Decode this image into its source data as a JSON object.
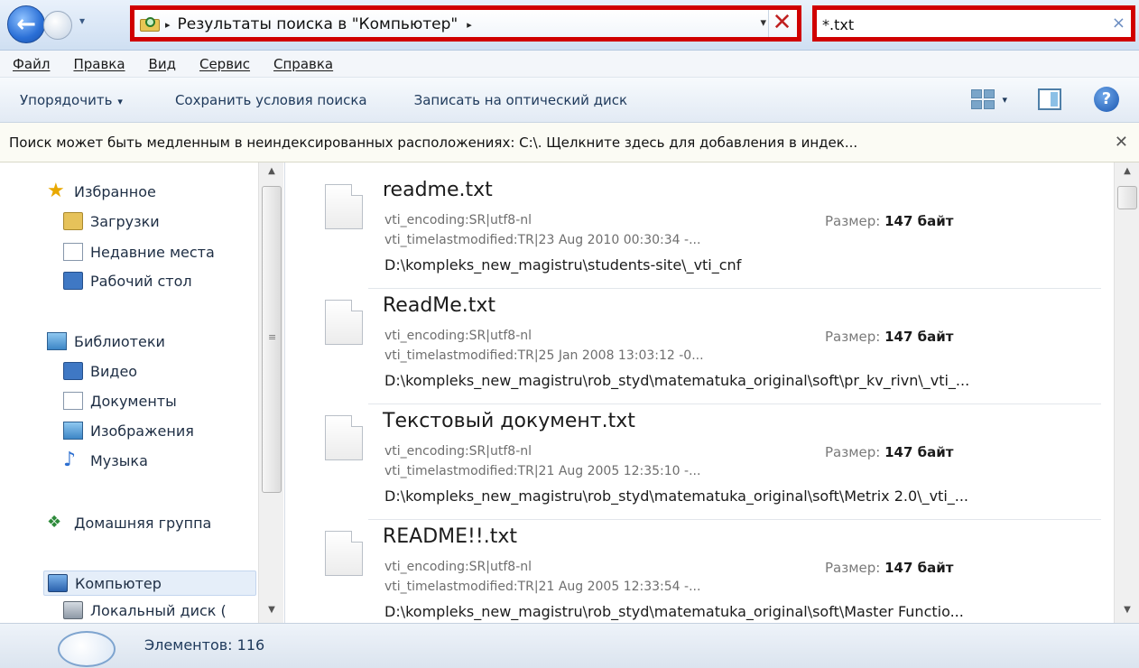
{
  "address": {
    "path": "Результаты поиска в \"Компьютер\"",
    "arrow": "▸",
    "dropdown": "▾",
    "clear": "✕"
  },
  "search": {
    "value": "*.txt",
    "clear": "×"
  },
  "menu": [
    "Файл",
    "Правка",
    "Вид",
    "Сервис",
    "Справка"
  ],
  "toolbar": {
    "organize": "Упорядочить",
    "save_search": "Сохранить условия поиска",
    "burn": "Записать на оптический диск",
    "caret": "▾"
  },
  "infobar": {
    "text": "Поиск может быть медленным в неиндексированных расположениях: C:\\. Щелкните здесь для добавления в индек...",
    "close": "✕"
  },
  "nav": {
    "favorites": "Избранное",
    "downloads": "Загрузки",
    "recent": "Недавние места",
    "desktop": "Рабочий стол",
    "libraries": "Библиотеки",
    "video": "Видео",
    "documents": "Документы",
    "pictures": "Изображения",
    "music": "Музыка",
    "homegroup": "Домашняя группа",
    "computer": "Компьютер",
    "local_disk": "Локальный диск (",
    "star_glyph": "★",
    "note_glyph": "♪",
    "home_glyph": "❖"
  },
  "results": [
    {
      "name": "readme.txt",
      "meta1": "vti_encoding:SR|utf8-nl",
      "meta2": "vti_timelastmodified:TR|23 Aug 2010 00:30:34 -...",
      "size_label": "Размер:",
      "size_value": "147 байт",
      "path": "D:\\kompleks_new_magistru\\students-site\\_vti_cnf"
    },
    {
      "name": "ReadMe.txt",
      "meta1": "vti_encoding:SR|utf8-nl",
      "meta2": "vti_timelastmodified:TR|25 Jan 2008 13:03:12 -0...",
      "size_label": "Размер:",
      "size_value": "147 байт",
      "path": "D:\\kompleks_new_magistru\\rob_styd\\matematuka_original\\soft\\pr_kv_rivn\\_vti_..."
    },
    {
      "name": "Текстовый документ.txt",
      "meta1": "vti_encoding:SR|utf8-nl",
      "meta2": "vti_timelastmodified:TR|21 Aug 2005 12:35:10 -...",
      "size_label": "Размер:",
      "size_value": "147 байт",
      "path": "D:\\kompleks_new_magistru\\rob_styd\\matematuka_original\\soft\\Metrix 2.0\\_vti_..."
    },
    {
      "name": "README!!.txt",
      "meta1": "vti_encoding:SR|utf8-nl",
      "meta2": "vti_timelastmodified:TR|21 Aug 2005 12:33:54 -...",
      "size_label": "Размер:",
      "size_value": "147 байт",
      "path": "D:\\kompleks_new_magistru\\rob_styd\\matematuka_original\\soft\\Master Functio..."
    }
  ],
  "status": {
    "text": "Элементов: 116"
  },
  "colors": {
    "highlight_border": "#d00000",
    "accent": "#1e395b"
  },
  "icons": {
    "back": "back-arrow-icon",
    "views": "views-grid-icon",
    "preview": "preview-pane-icon",
    "help": "help-icon"
  }
}
